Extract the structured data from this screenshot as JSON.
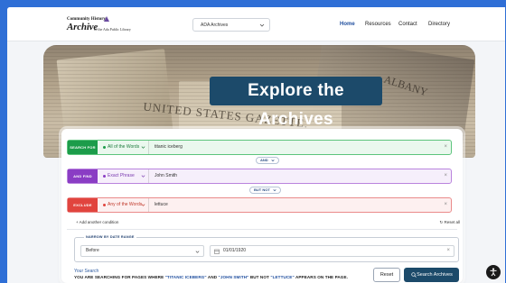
{
  "header": {
    "logo": {
      "line1": "Community History",
      "line2": "Archive",
      "line3": "of the Ada Public Library"
    },
    "collection_select": "ADA Archives",
    "nav": [
      "Home",
      "Resources",
      "Contact",
      "Directory"
    ]
  },
  "hero": {
    "title": "Explore the Archives",
    "background_text_1": "UNITED STATES GAZETTE.",
    "background_text_2": "ALBANY"
  },
  "search": {
    "rows": [
      {
        "tag": "SEARCH FOR",
        "mode": "All of the Words",
        "term": "titanic iceberg",
        "color": "#1c9c4a"
      },
      {
        "tag": "AND FIND",
        "mode": "Exact Phrase",
        "term": "John Smith",
        "color": "#8a3dc4"
      },
      {
        "tag": "EXCLUDE",
        "mode": "Any of the Words",
        "term": "lettuce",
        "color": "#e1443e"
      }
    ],
    "operators": [
      "AND",
      "BUT NOT"
    ],
    "clear_symbol": "×",
    "add_condition": "+ Add another condition",
    "reset_all": "↻ Reset all"
  },
  "date_range": {
    "legend": "NARROW BY DATE RANGE",
    "qualifier": "Before",
    "date": "01/01/1920"
  },
  "summary": {
    "label": "Your Search",
    "prefix": "YOU ARE SEARCHING FOR PAGES WHERE ",
    "term1": "\"TITANIC ICEBERG\"",
    "mid": " AND ",
    "term2": "\"JOHN SMITH\"",
    "mid2": " BUT NOT ",
    "term3": "\"LETTUCE\"",
    "suffix": " APPEARS ON THE PAGE."
  },
  "buttons": {
    "reset": "Reset",
    "search": "Search Archives"
  },
  "colors": {
    "accent": "#1c4a6a",
    "link": "#1f4e9e"
  }
}
